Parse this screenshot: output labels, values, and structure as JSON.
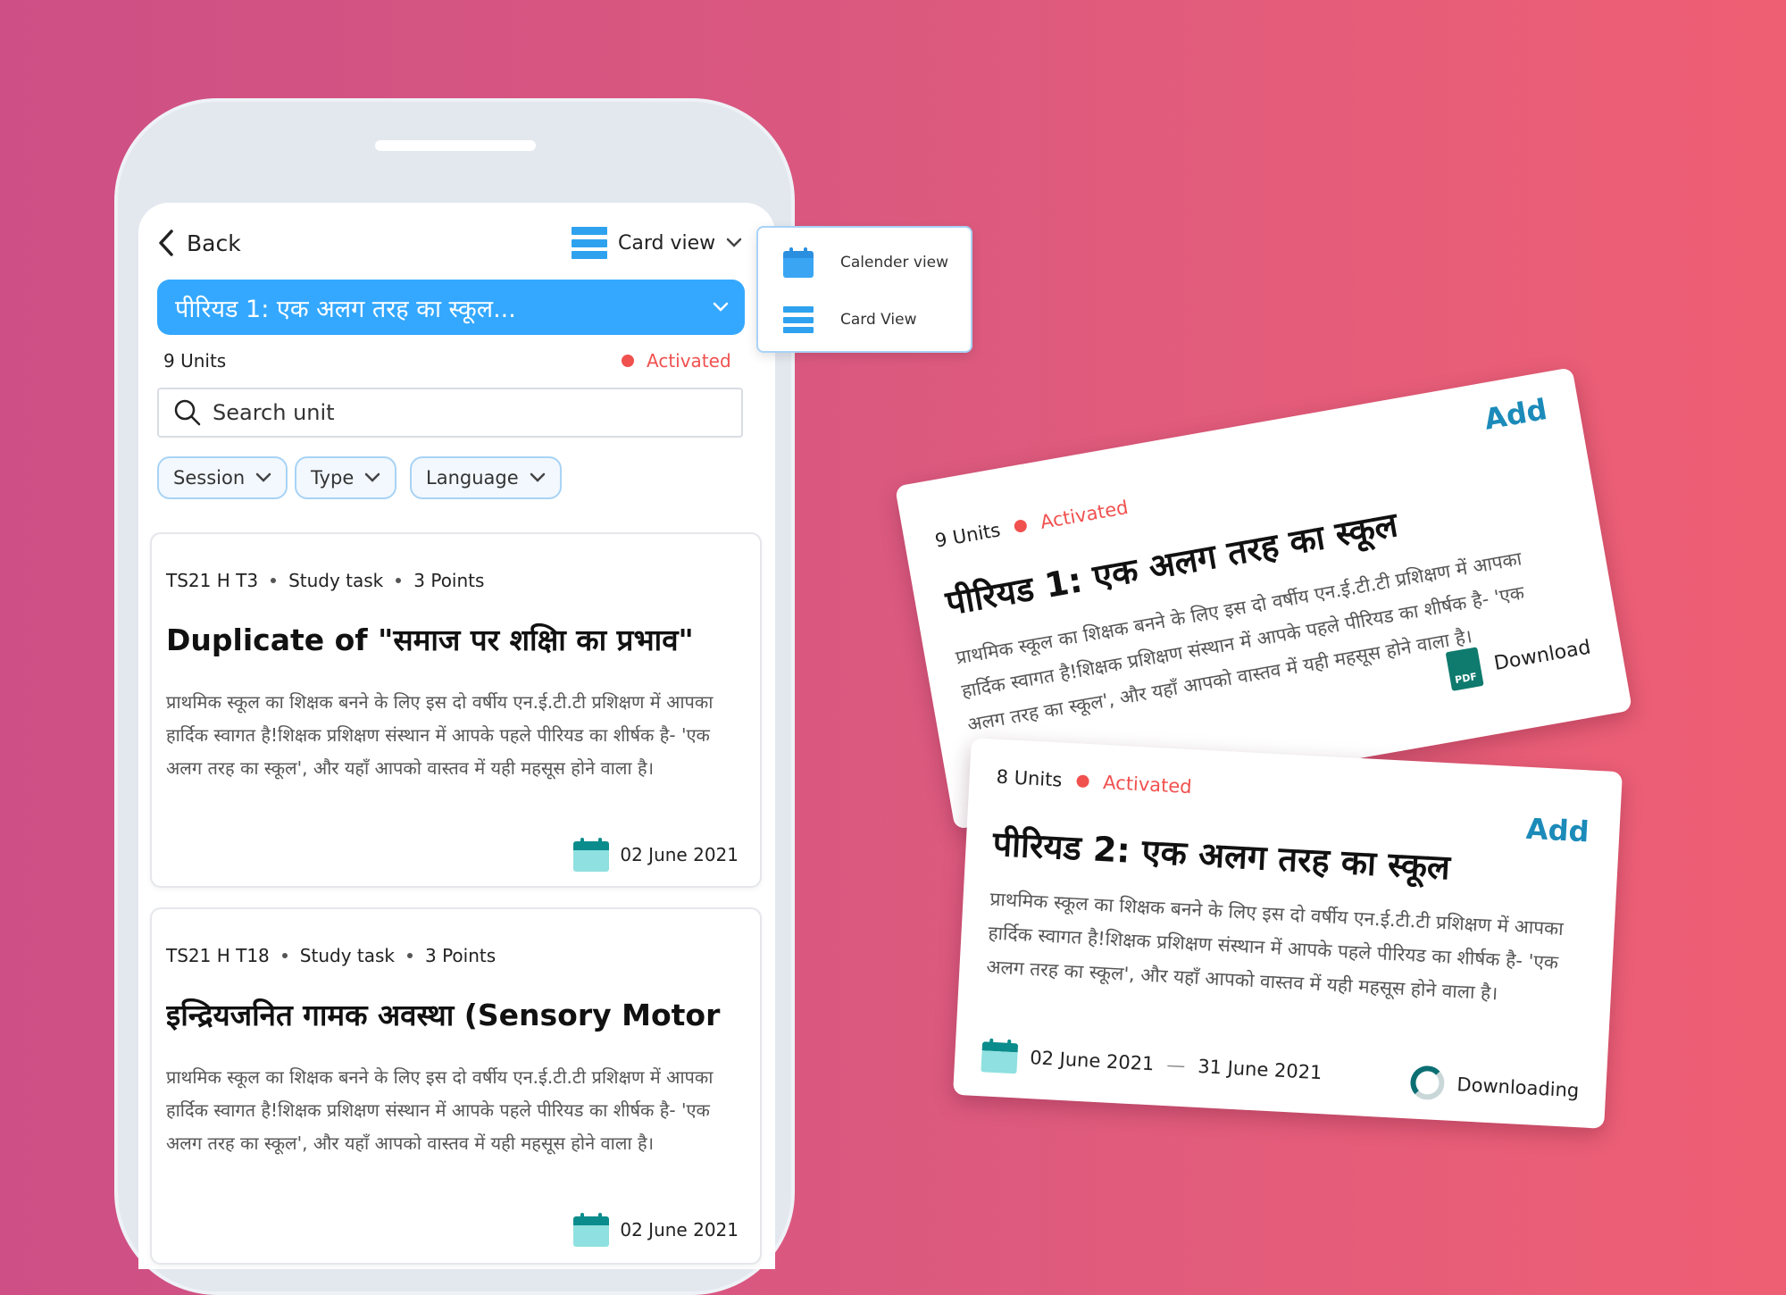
{
  "header": {
    "back_label": "Back",
    "view_label": "Card view"
  },
  "period_select": {
    "label": "पीरियड 1: एक अलग तरह का स्कूल..."
  },
  "summary": {
    "units": "9 Units",
    "status": "Activated"
  },
  "search": {
    "placeholder": "Search unit"
  },
  "filters": [
    "Session",
    "Type",
    "Language"
  ],
  "view_menu": {
    "calendar": "Calender view",
    "card": "Card View"
  },
  "units": [
    {
      "code": "TS21 H T3",
      "type": "Study task",
      "points": "3 Points",
      "title": "Duplicate of \"समाज पर शक्षिा का प्रभाव\"",
      "desc": "प्राथमिक स्कूल का शिक्षक बनने के लिए इस दो वर्षीय एन.ई.टी.टी प्रशिक्षण में आपका हार्दिक स्वागत है!शिक्षक प्रशिक्षण संस्थान में आपके पहले पीरियड का शीर्षक है- 'एक अलग तरह का स्कूल', और यहाँ आपको वास्तव में यही महसूस होने वाला है।",
      "date": "02 June 2021"
    },
    {
      "code": "TS21 H T18",
      "type": "Study task",
      "points": "3 Points",
      "title": "इन्द्रियजनित गामक अवस्था (Sensory Motor",
      "desc": "प्राथमिक स्कूल का शिक्षक बनने के लिए इस दो वर्षीय एन.ई.टी.टी प्रशिक्षण में आपका हार्दिक स्वागत है!शिक्षक प्रशिक्षण संस्थान में आपके पहले पीरियड का शीर्षक है- 'एक अलग तरह का स्कूल', और यहाँ आपको वास्तव में यही महसूस होने वाला है।",
      "date": "02 June 2021"
    }
  ],
  "period_cards": [
    {
      "units": "9 Units",
      "status": "Activated",
      "add": "Add",
      "title": "पीरियड 1: एक अलग तरह का स्कूल",
      "desc": "प्राथमिक स्कूल का शिक्षक बनने के लिए इस दो वर्षीय एन.ई.टी.टी प्रशिक्षण में आपका हार्दिक स्वागत है!शिक्षक प्रशिक्षण संस्थान में आपके पहले पीरियड का शीर्षक है- 'एक अलग तरह का स्कूल', और यहाँ आपको वास्तव में यही महसूस होने वाला है।",
      "action": "Download",
      "pdf": "PDF"
    },
    {
      "units": "8 Units",
      "status": "Activated",
      "add": "Add",
      "title": "पीरियड 2: एक अलग तरह का स्कूल",
      "desc": "प्राथमिक स्कूल का शिक्षक बनने के लिए इस दो वर्षीय एन.ई.टी.टी प्रशिक्षण में आपका हार्दिक स्वागत है!शिक्षक प्रशिक्षण संस्थान में आपके पहले पीरियड का शीर्षक है- 'एक अलग तरह का स्कूल', और यहाँ आपको वास्तव में यही महसूस होने वाला है।",
      "date_start": "02 June 2021",
      "date_sep": "—",
      "date_end": "31 June 2021",
      "action": "Downloading"
    }
  ],
  "colors": {
    "accent": "#34a8ff",
    "activated": "#f0514f",
    "add": "#1c8bb9",
    "calendar": "#0b8c8c"
  }
}
